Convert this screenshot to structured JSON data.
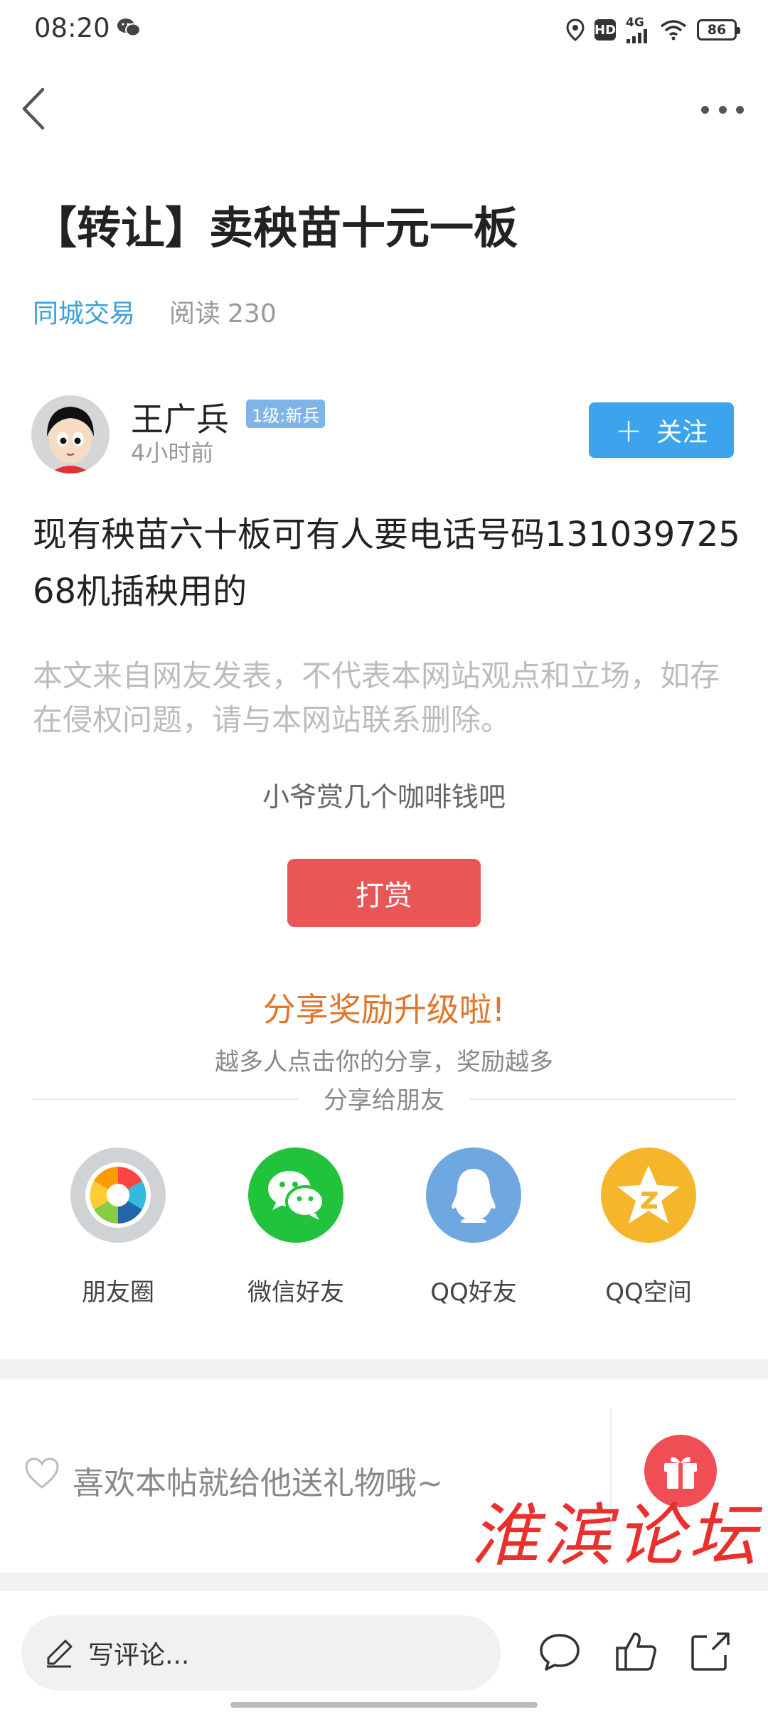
{
  "status_bar": {
    "time": "08:20",
    "hd": "HD",
    "network": "4G",
    "battery": "86"
  },
  "post": {
    "title": "【转让】卖秧苗十元一板",
    "category": "同城交易",
    "read_label": "阅读",
    "read_count": "230",
    "body": "现有秧苗六十板可有人要电话号码13103972568机插秧用的",
    "disclaimer": "本文来自网友发表，不代表本网站观点和立场，如存在侵权问题，请与本网站联系删除。"
  },
  "author": {
    "name": "王广兵",
    "level": "1级:新兵",
    "time": "4小时前",
    "follow_label": "关注"
  },
  "reward": {
    "prompt": "小爷赏几个咖啡钱吧",
    "button": "打赏"
  },
  "share": {
    "headline": "分享奖励升级啦!",
    "subtitle": "越多人点击你的分享，奖励越多",
    "label": "分享给朋友",
    "items": [
      {
        "name": "朋友圈",
        "icon": "moments-icon",
        "color": "#cfd3d6"
      },
      {
        "name": "微信好友",
        "icon": "wechat-icon",
        "color": "#22c33c"
      },
      {
        "name": "QQ好友",
        "icon": "qq-icon",
        "color": "#6fa8e0"
      },
      {
        "name": "QQ空间",
        "icon": "qzone-icon",
        "color": "#f5b62b"
      }
    ]
  },
  "gift": {
    "text": "喜欢本帖就给他送礼物哦~"
  },
  "watermark": "淮滨论坛",
  "bottom_bar": {
    "comment_placeholder": "写评论..."
  },
  "colors": {
    "accent_blue": "#3ba4ec",
    "category_blue": "#3aa0d8",
    "reward_red": "#e85656",
    "share_orange": "#e0772d",
    "watermark_red": "#e8302e"
  }
}
